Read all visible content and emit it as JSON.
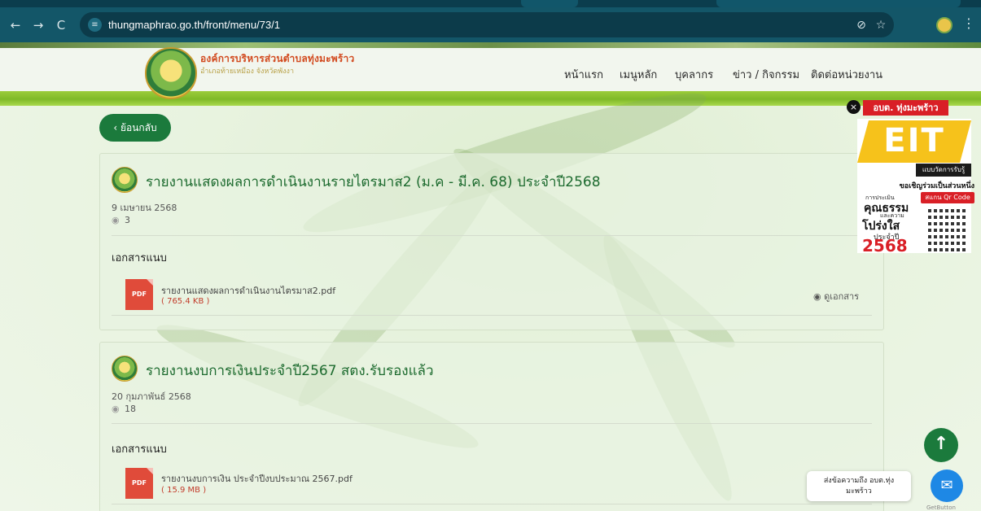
{
  "browser": {
    "url": "thungmaphrao.go.th/front/menu/73/1",
    "back_icon": "←",
    "forward_icon": "→",
    "reload_icon": "C",
    "site_info_icon": "≡",
    "hide_icon": "⊘",
    "bookmark_icon": "☆",
    "menu_icon": "⋮"
  },
  "site": {
    "org_name": "องค์การบริหารส่วนตำบลทุ่งมะพร้าว",
    "org_sub": "อำเภอท้ายเหมือง จังหวัดพังงา",
    "nav": [
      "หน้าแรก",
      "เมนูหลัก",
      "บุคลากร",
      "ข่าว / กิจกรรม",
      "ติดต่อหน่วยงาน"
    ]
  },
  "page": {
    "back_label": "‹ ย้อนกลับ",
    "posts": [
      {
        "title": "รายงานแสดงผลการดำเนินงานรายไตรมาส2 (ม.ค - มี.ค. 68) ประจำปี2568",
        "date": "9 เมษายน 2568",
        "views": "3",
        "attachments_label": "เอกสารแนบ",
        "file_name": "รายงานแสดงผลการดำเนินงานไตรมาส2.pdf",
        "file_size": "( 765.4 KB )",
        "file_type": "PDF",
        "view_label": "ดูเอกสาร"
      },
      {
        "title": "รายงานงบการเงินประจำปี2567 สตง.รับรองแล้ว",
        "date": "20 กุมภาพันธ์ 2568",
        "views": "18",
        "attachments_label": "เอกสารแนบ",
        "file_name": "รายงานงบการเงิน ประจำปีงบประมาณ 2567.pdf",
        "file_size": "( 15.9 MB )",
        "file_type": "PDF"
      }
    ]
  },
  "eit_banner": {
    "close": "×",
    "tag": "อบต. ทุ่งมะพร้าว",
    "title": "EIT",
    "subtitle": "แบบวัดการรับรู้",
    "invite": "ขอเชิญร่วมเป็นส่วนหนึ่ง",
    "scan": "สแกน Qr Code",
    "line1": "การประเมิน",
    "line2": "คุณธรรม",
    "line3": "และความ",
    "line4": "โปร่งใส",
    "line5": "ประจำปี",
    "year": "2568"
  },
  "floating": {
    "scroll_top_icon": "↑",
    "chat_text_1": "ส่งข้อความถึง อบต.ทุ่ง",
    "chat_text_2": "มะพร้าว",
    "messenger_icon": "✉",
    "getbutton": "GetButton"
  },
  "colors": {
    "accent": "#1b7a3c",
    "title_green": "#1d6b2f",
    "pdf_red": "#e04b3a",
    "browser_bar": "#135668"
  }
}
